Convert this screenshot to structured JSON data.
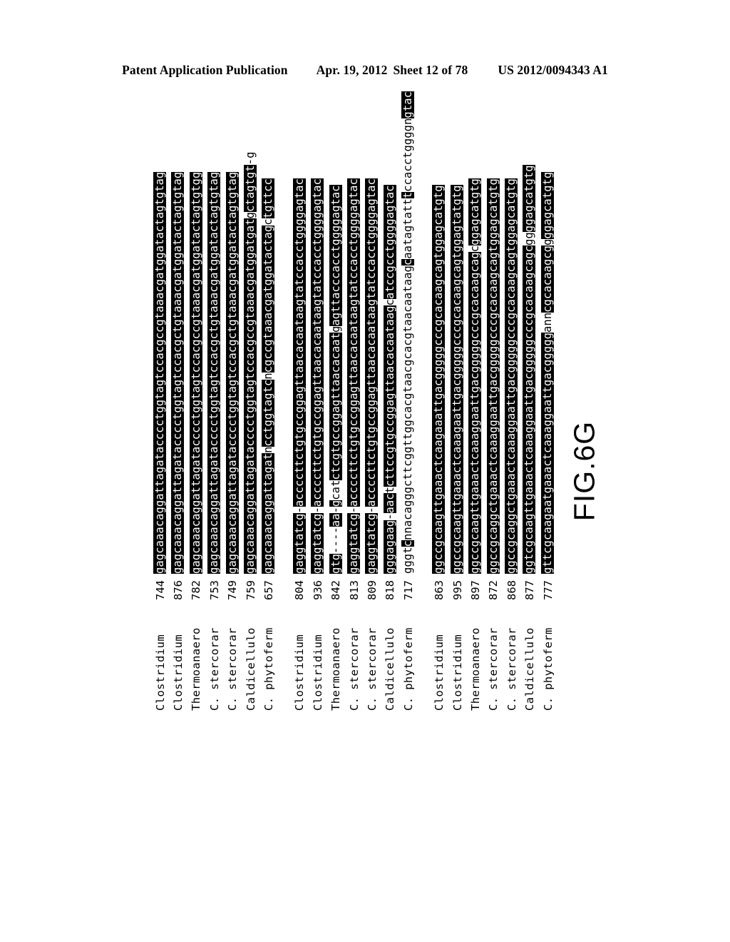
{
  "header": {
    "publication": "Patent Application Publication",
    "date": "Apr. 19, 2012",
    "sheet": "Sheet 12 of 78",
    "doc_number": "US 2012/0094343 A1"
  },
  "figure": {
    "caption": "FIG.6G",
    "type": "multiple-sequence-alignment",
    "rotation_deg": -90,
    "num_blocks": 3,
    "num_rows": 7,
    "highlight_colors": {
      "conserved_bg": "#000000",
      "conserved_fg": "#ffffff",
      "variant_bg": "#ffffff",
      "variant_fg": "#000000"
    },
    "taxa": [
      "Clostridium",
      "Clostridium",
      "Thermoanaero",
      "C. stercorar",
      "C. stercorar",
      "Caldicellulo",
      "C. phytoferm"
    ]
  },
  "chart_data": {
    "type": "table",
    "title": "FIG.6G",
    "blocks": [
      {
        "index": 1,
        "rows": [
          {
            "name": "Clostridium",
            "pos": "744",
            "segments": [
              {
                "t": "gagcaaacaggattagatacccctggtagtccacgccgtaaacgatggatactagtgtag",
                "hl": true
              }
            ]
          },
          {
            "name": "Clostridium",
            "pos": "876",
            "segments": [
              {
                "t": "gagcaaacaggattagatacccctggtagtccacgctgtaaacgatggatactagtgtag",
                "hl": true
              }
            ]
          },
          {
            "name": "Thermoanaero",
            "pos": "782",
            "segments": [
              {
                "t": "gagcaaacaggattagatacccctggtagtccacgccgtaaacgatggatactagtgtgg",
                "hl": true
              }
            ]
          },
          {
            "name": "C. stercorar",
            "pos": "753",
            "segments": [
              {
                "t": "gagcaaacaggattagatacccctggtagtccacgctgtaaacgatggatactagtgtag",
                "hl": true
              }
            ]
          },
          {
            "name": "C. stercorar",
            "pos": "749",
            "segments": [
              {
                "t": "gagcaaacaggattagatacccctggtagtccacgctgtaaacgatggatactagtgtag",
                "hl": true
              }
            ]
          },
          {
            "name": "Caldicellulo",
            "pos": "759",
            "segments": [
              {
                "t": "gagcaaacaggattagatacccctggtagtccacgccgtaaacgatggatgat",
                "hl": true
              },
              {
                "t": "g",
                "hl": false
              },
              {
                "t": "ctagtgt",
                "hl": true
              },
              {
                "t": "-g",
                "hl": false
              }
            ]
          },
          {
            "name": "C. phytoferm",
            "pos": "657",
            "segments": [
              {
                "t": "gagcaaacaggattagat",
                "hl": true
              },
              {
                "t": "n",
                "hl": false
              },
              {
                "t": "cctggtagtc",
                "hl": true
              },
              {
                "t": "n",
                "hl": false
              },
              {
                "t": "cgccgtaaacgatggatactag",
                "hl": true
              },
              {
                "t": "c",
                "hl": false
              },
              {
                "t": "tgttcc",
                "hl": true
              }
            ]
          }
        ]
      },
      {
        "index": 2,
        "rows": [
          {
            "name": "Clostridium",
            "pos": "804",
            "segments": [
              {
                "t": "gaggtatcg",
                "hl": true
              },
              {
                "t": "-",
                "hl": false
              },
              {
                "t": "accccttctgtgccggagttaacacaataagtatccacctggggagtac",
                "hl": true
              }
            ]
          },
          {
            "name": "Clostridium",
            "pos": "936",
            "segments": [
              {
                "t": "gaggtatcg",
                "hl": true
              },
              {
                "t": "-",
                "hl": false
              },
              {
                "t": "accccttctgtgccggagttaacacaataagtatccacctggggagtac",
                "hl": true
              }
            ]
          },
          {
            "name": "Thermoanaero",
            "pos": "842",
            "segments": [
              {
                "t": "gtg",
                "hl": true
              },
              {
                "t": "----",
                "hl": false
              },
              {
                "t": "aa",
                "hl": true
              },
              {
                "t": "-",
                "hl": false
              },
              {
                "t": "g",
                "hl": true
              },
              {
                "t": "cat",
                "hl": false
              },
              {
                "t": "ctcgtgccggagttaacacaat",
                "hl": true
              },
              {
                "t": "g",
                "hl": false
              },
              {
                "t": "agttacccacctggggagtac",
                "hl": true
              }
            ]
          },
          {
            "name": "C. stercorar",
            "pos": "813",
            "segments": [
              {
                "t": "gaggtatcg",
                "hl": true
              },
              {
                "t": "-",
                "hl": false
              },
              {
                "t": "accccttctgtgccggagttaacacaataagtatccacctggggagtac",
                "hl": true
              }
            ]
          },
          {
            "name": "C. stercorar",
            "pos": "809",
            "segments": [
              {
                "t": "gaggtatcg",
                "hl": true
              },
              {
                "t": "-",
                "hl": false
              },
              {
                "t": "accccttctgtgccggagttaacacaataagtatccacctggggagtac",
                "hl": true
              }
            ]
          },
          {
            "name": "Caldicellulo",
            "pos": "818",
            "segments": [
              {
                "t": "gggagaag",
                "hl": true
              },
              {
                "t": "-",
                "hl": false
              },
              {
                "t": "aac",
                "hl": true
              },
              {
                "t": "t",
                "hl": false
              },
              {
                "t": "cttccgtgccggagttaacacaataag",
                "hl": true
              },
              {
                "t": "c",
                "hl": false
              },
              {
                "t": "atccgcctggggagtac",
                "hl": true
              }
            ]
          },
          {
            "name": "C. phytoferm",
            "pos": "717",
            "segments": [
              {
                "t": "gggt",
                "hl": false
              },
              {
                "t": "c",
                "hl": true
              },
              {
                "t": "nnacagggcttcggttggcacgtaacgcacgtaacaataag",
                "hl": false
              },
              {
                "t": "c",
                "hl": true
              },
              {
                "t": "aatagtatt",
                "hl": false
              },
              {
                "t": "t",
                "hl": true
              },
              {
                "t": "ccacctggggn",
                "hl": false
              },
              {
                "t": "gtac",
                "hl": true
              }
            ]
          }
        ]
      },
      {
        "index": 3,
        "rows": [
          {
            "name": "Clostridium",
            "pos": "863",
            "segments": [
              {
                "t": "ggccgcaagttgaaactcaagaaattgacgggggcccgcacaagcagtggagcatgtg",
                "hl": true
              }
            ]
          },
          {
            "name": "Clostridium",
            "pos": "995",
            "segments": [
              {
                "t": "ggccgcaagttgaaactcaaagaattgacgggggcccgcacaagcagtggagtatgtg",
                "hl": true
              }
            ]
          },
          {
            "name": "Thermoanaero",
            "pos": "897",
            "segments": [
              {
                "t": "ggccgcaagttgaaactcaaaggaattgacgggggcccgcacaagcag",
                "hl": true
              },
              {
                "t": "c",
                "hl": false
              },
              {
                "t": "ggagcatgtg",
                "hl": true
              }
            ]
          },
          {
            "name": "C. stercorar",
            "pos": "872",
            "segments": [
              {
                "t": "ggccgcaggctgaaactcaaaggaattgacgggggcccgcacaagcagtggagcatgtg",
                "hl": true
              }
            ]
          },
          {
            "name": "C. stercorar",
            "pos": "868",
            "segments": [
              {
                "t": "ggccgcaggctgaaactcaaaggaattgacgggggcccgcacaagcagtggagcatgtg",
                "hl": true
              }
            ]
          },
          {
            "name": "Caldicellulo",
            "pos": "877",
            "segments": [
              {
                "t": "ggtcgcaagttgaaactcaaaggaattgacgggggcccgcacaagcagc",
                "hl": true
              },
              {
                "t": "gg",
                "hl": false
              },
              {
                "t": "ggagcatgtg",
                "hl": true
              }
            ]
          },
          {
            "name": "C. phytoferm",
            "pos": "777",
            "segments": [
              {
                "t": "gttcgcaagaatgaaactcaaaggaattgacggggg",
                "hl": true
              },
              {
                "t": "ann",
                "hl": false
              },
              {
                "t": "cgcacaagcg",
                "hl": true
              },
              {
                "t": "g",
                "hl": false
              },
              {
                "t": "ggagcatgtg",
                "hl": true
              }
            ]
          }
        ]
      }
    ]
  }
}
